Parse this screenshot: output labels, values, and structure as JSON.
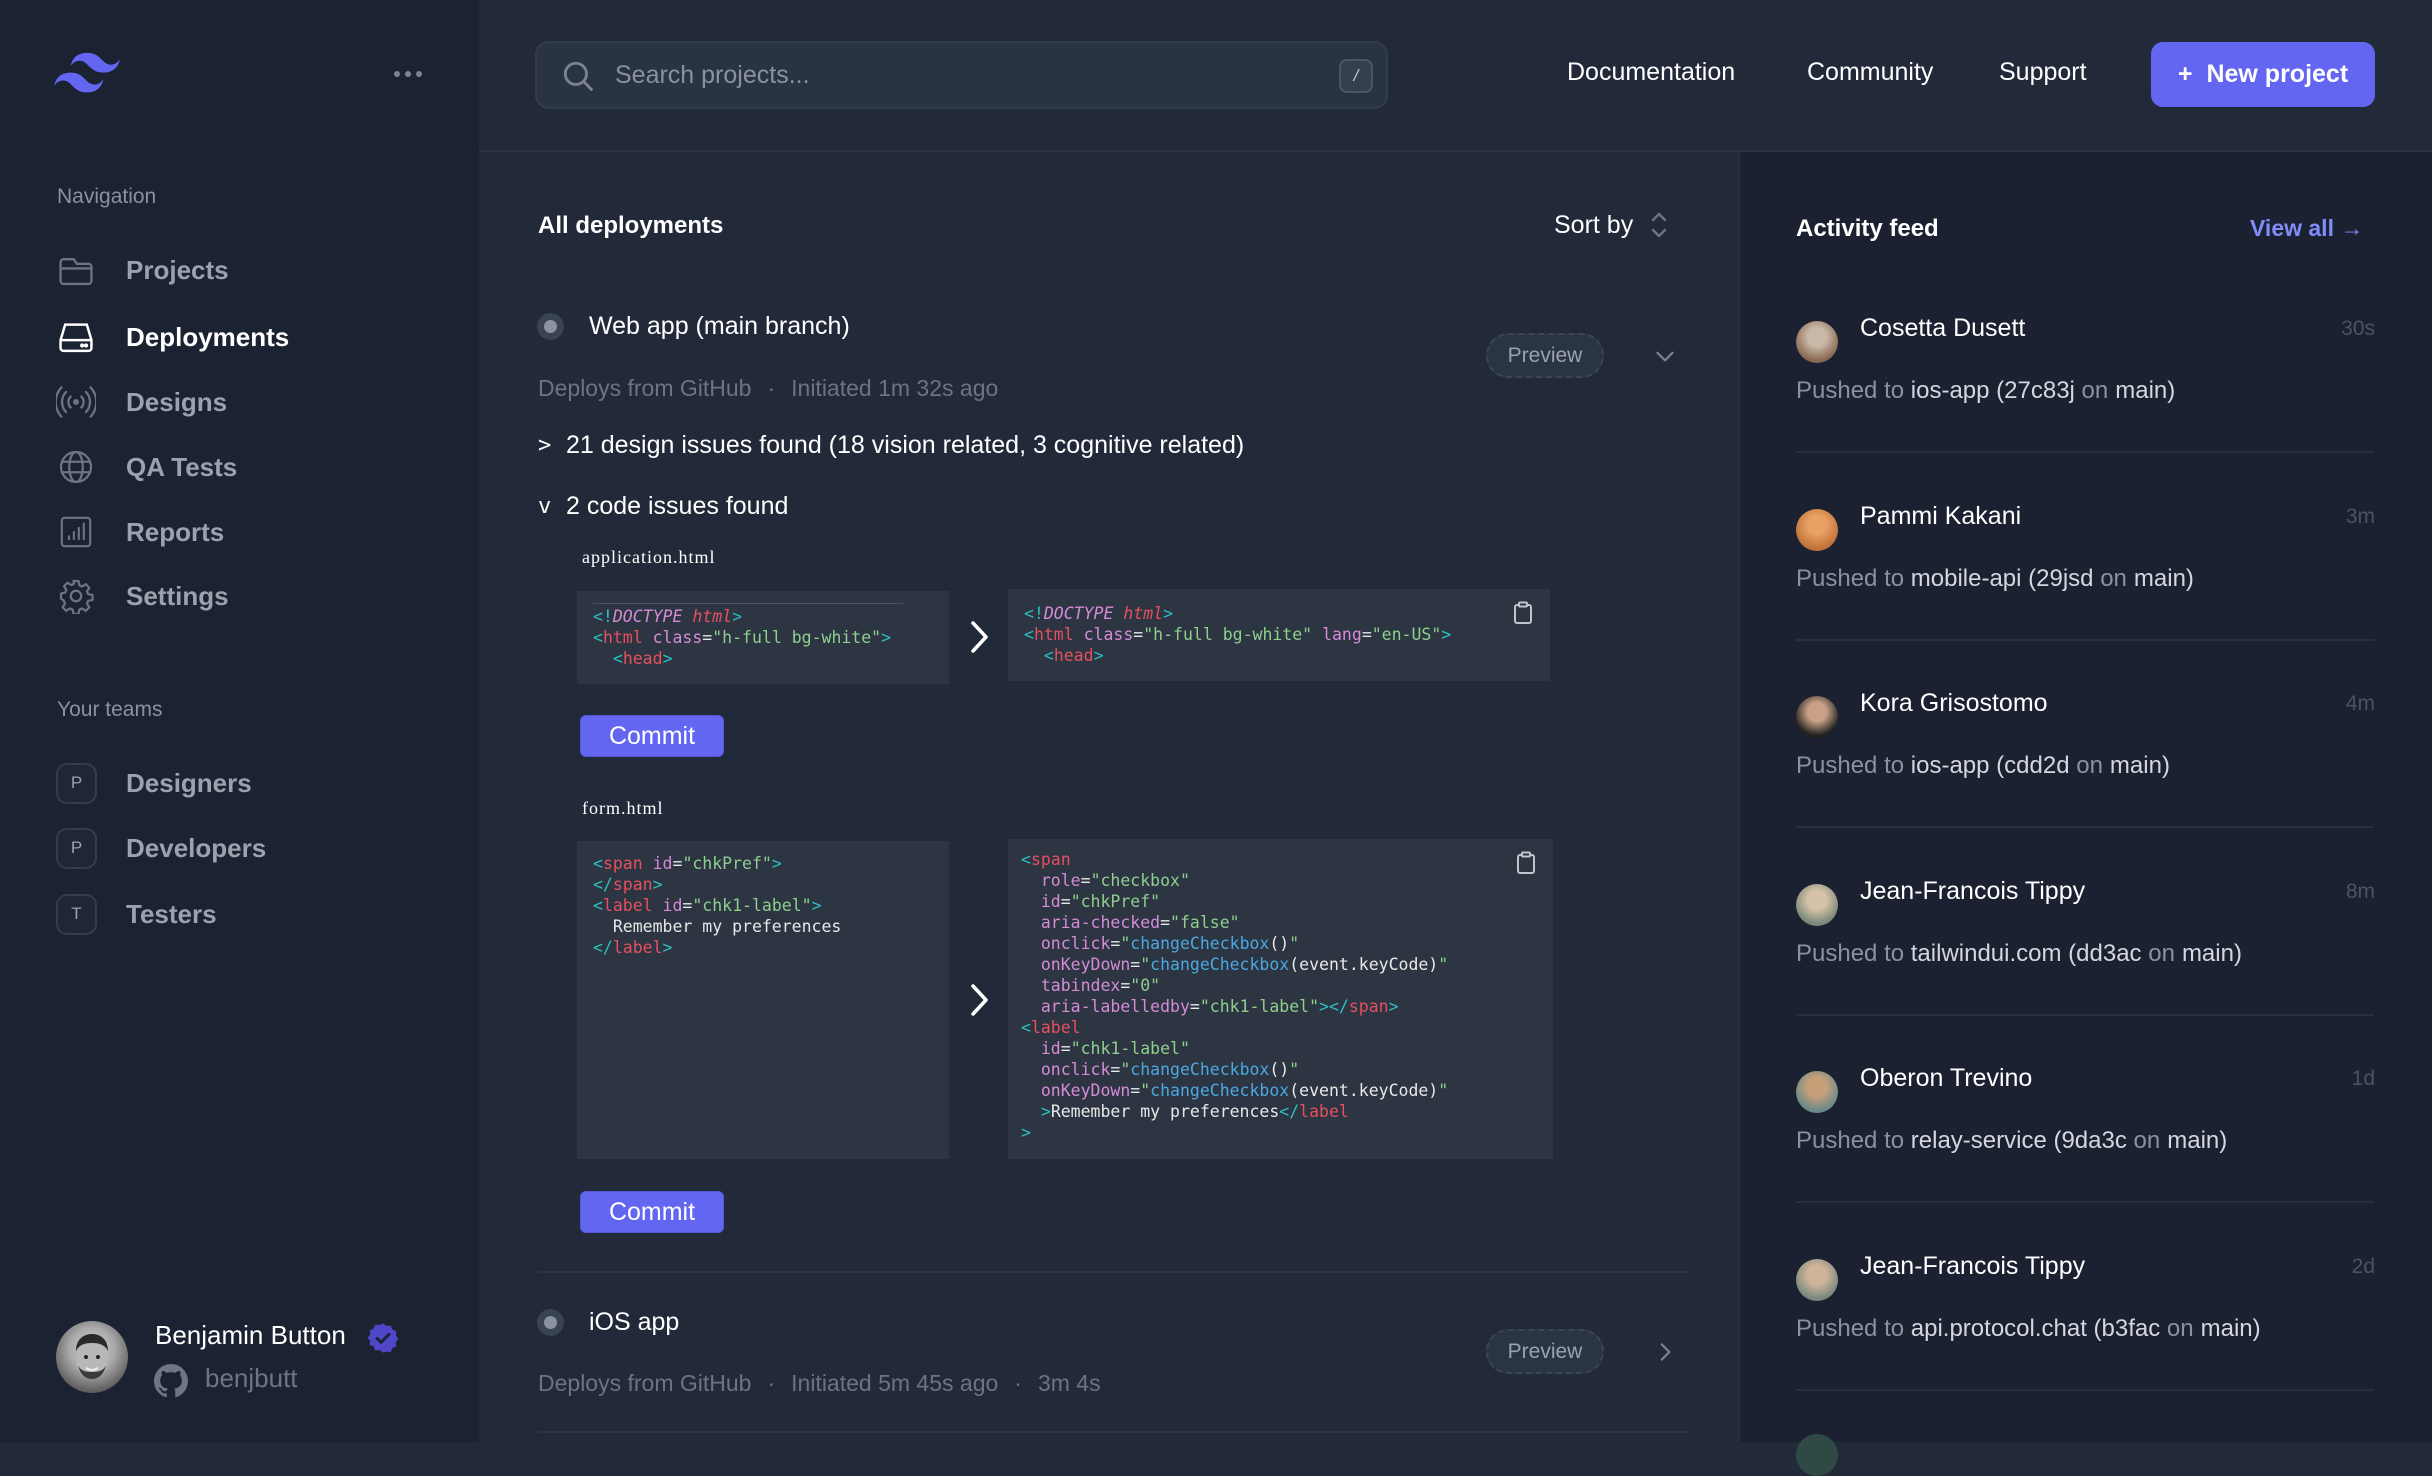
{
  "brand": {
    "logo_icon": "tailwind-wave-logo",
    "accent": "#6366f1",
    "menu_icon": "ellipsis-horizontal-icon"
  },
  "sidebar": {
    "nav_heading": "Navigation",
    "nav_items": [
      {
        "label": "Projects",
        "icon": "folder-icon",
        "active": false
      },
      {
        "label": "Deployments",
        "icon": "server-icon",
        "active": true
      },
      {
        "label": "Designs",
        "icon": "signal-icon",
        "active": false
      },
      {
        "label": "QA Tests",
        "icon": "globe-icon",
        "active": false
      },
      {
        "label": "Reports",
        "icon": "chart-bar-icon",
        "active": false
      },
      {
        "label": "Settings",
        "icon": "gear-icon",
        "active": false
      }
    ],
    "teams_heading": "Your teams",
    "teams": [
      {
        "initial": "P",
        "label": "Designers"
      },
      {
        "initial": "P",
        "label": "Developers"
      },
      {
        "initial": "T",
        "label": "Testers"
      }
    ],
    "user": {
      "name": "Benjamin Button",
      "verified": true,
      "handle": "benjbutt",
      "handle_icon": "github-icon"
    }
  },
  "header": {
    "search_placeholder": "Search projects...",
    "search_value": "",
    "shortcut_key": "/",
    "links": [
      "Documentation",
      "Community",
      "Support"
    ],
    "new_project_label": "New project",
    "new_project_icon": "+"
  },
  "deployments": {
    "title": "All deployments",
    "sort_label": "Sort by",
    "items": [
      {
        "name": "Web app (main branch)",
        "source": "Deploys from GitHub",
        "initiated": "Initiated 1m 32s ago",
        "duration": "",
        "preview_label": "Preview",
        "expanded": true,
        "design_issues": {
          "caret": ">",
          "text": "21 design issues found (18 vision related, 3 cognitive related)"
        },
        "code_issues": {
          "caret": "v",
          "text": "2 code issues found",
          "files": [
            {
              "filename": "application.html",
              "commit_label": "Commit"
            },
            {
              "filename": "form.html",
              "commit_label": "Commit"
            }
          ]
        }
      },
      {
        "name": "iOS app",
        "source": "Deploys from GitHub",
        "initiated": "Initiated 5m 45s ago",
        "duration": "3m 4s",
        "preview_label": "Preview",
        "expanded": false
      }
    ]
  },
  "activity": {
    "title": "Activity feed",
    "view_all_label": "View all →",
    "items": [
      {
        "name": "Cosetta Dusett",
        "time": "30s",
        "prefix": "Pushed to",
        "repo": "ios-app",
        "commit": "(27c83j",
        "on": "on",
        "branch": "main)"
      },
      {
        "name": "Pammi Kakani",
        "time": "3m",
        "prefix": "Pushed to",
        "repo": "mobile-api",
        "commit": "(29jsd",
        "on": "on",
        "branch": "main)"
      },
      {
        "name": "Kora Grisostomo",
        "time": "4m",
        "prefix": "Pushed to",
        "repo": "ios-app",
        "commit": "(cdd2d",
        "on": "on",
        "branch": "main)"
      },
      {
        "name": "Jean-Francois Tippy",
        "time": "8m",
        "prefix": "Pushed to",
        "repo": "tailwindui.com",
        "commit": "(dd3ac",
        "on": "on",
        "branch": "main)"
      },
      {
        "name": "Oberon Trevino",
        "time": "1d",
        "prefix": "Pushed to",
        "repo": "relay-service",
        "commit": "(9da3c",
        "on": "on",
        "branch": "main)"
      },
      {
        "name": "Jean-Francois Tippy",
        "time": "2d",
        "prefix": "Pushed to",
        "repo": "api.protocol.chat",
        "commit": "(b3fac",
        "on": "on",
        "branch": "main)"
      }
    ]
  }
}
